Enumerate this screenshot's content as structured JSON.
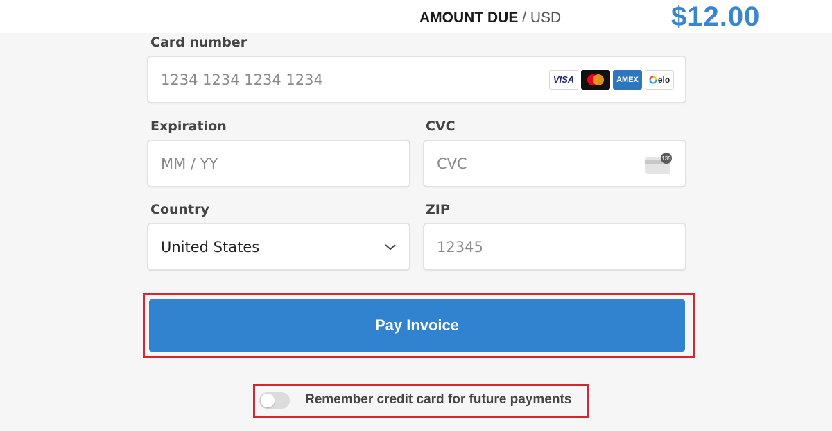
{
  "header": {
    "amount_label": "AMOUNT DUE",
    "separator": " / ",
    "currency": "USD",
    "amount": "$12.00"
  },
  "form": {
    "card_number": {
      "label": "Card number",
      "placeholder": "1234 1234 1234 1234",
      "brands": [
        "VISA",
        "mastercard",
        "AMEX",
        "elo"
      ]
    },
    "expiration": {
      "label": "Expiration",
      "placeholder": "MM / YY"
    },
    "cvc": {
      "label": "CVC",
      "placeholder": "CVC",
      "icon_text": "135"
    },
    "country": {
      "label": "Country",
      "value": "United States"
    },
    "zip": {
      "label": "ZIP",
      "placeholder": "12345"
    }
  },
  "actions": {
    "pay_label": "Pay Invoice",
    "remember_label": "Remember credit card for future payments",
    "remember_on": false
  },
  "colors": {
    "accent": "#3283cf",
    "amount": "#3a86cc",
    "highlight": "#d9262e"
  }
}
